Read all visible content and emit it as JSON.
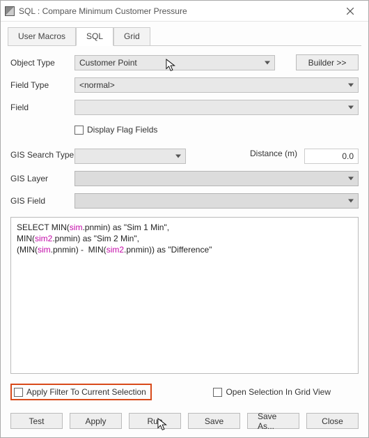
{
  "window": {
    "title": "SQL : Compare Minimum Customer Pressure"
  },
  "tabs": {
    "user_macros": "User Macros",
    "sql": "SQL",
    "grid": "Grid"
  },
  "fields": {
    "object_type_label": "Object Type",
    "object_type_value": "Customer Point",
    "builder_btn": "Builder >>",
    "field_type_label": "Field Type",
    "field_type_value": "<normal>",
    "field_label": "Field",
    "field_value": "",
    "display_flag_label": "Display Flag Fields",
    "gis_search_label": "GIS Search Type",
    "gis_search_value": "",
    "distance_label": "Distance (m)",
    "distance_value": "0.0",
    "gis_layer_label": "GIS Layer",
    "gis_layer_value": "",
    "gis_field_label": "GIS Field",
    "gis_field_value": ""
  },
  "sql": {
    "l1a": "SELECT MIN(",
    "l1b": "sim",
    "l1c": ".pnmin) as \"Sim 1 Min\",",
    "l2a": "MIN(",
    "l2b": "sim2",
    "l2c": ".pnmin) as \"Sim 2 Min\",",
    "l3a": "(MIN(",
    "l3b": "sim",
    "l3c": ".pnmin) -  MIN(",
    "l3d": "sim2",
    "l3e": ".pnmin)) as \"Difference\""
  },
  "bottom": {
    "apply_filter": "Apply Filter To Current Selection",
    "open_grid": "Open Selection In Grid View"
  },
  "buttons": {
    "test": "Test",
    "apply": "Apply",
    "run": "Run",
    "save": "Save",
    "save_as": "Save As...",
    "close": "Close"
  }
}
